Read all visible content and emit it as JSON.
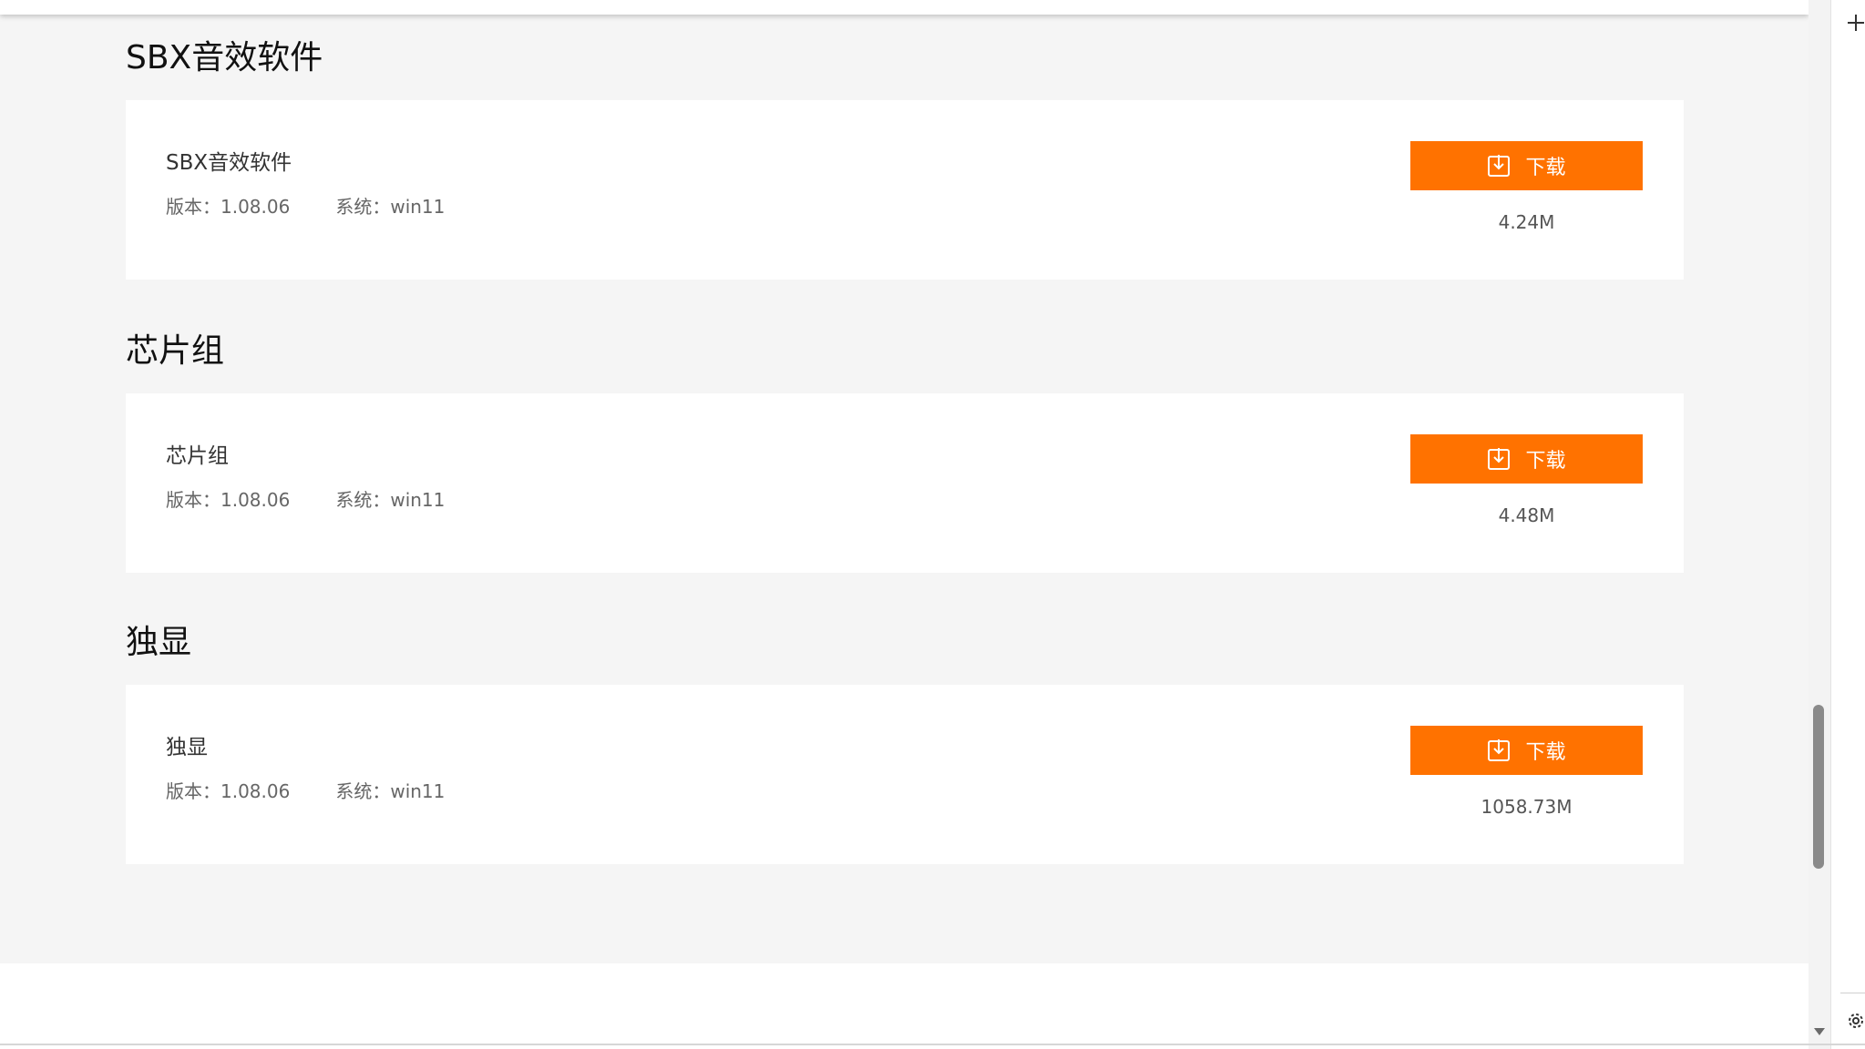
{
  "sections": [
    {
      "title": "SBX音效软件",
      "item_name": "SBX音效软件",
      "version_label": "版本：1.08.06",
      "system_label": "系统：win11",
      "download_label": "下载",
      "size": "4.24M"
    },
    {
      "title": "芯片组",
      "item_name": "芯片组",
      "version_label": "版本：1.08.06",
      "system_label": "系统：win11",
      "download_label": "下载",
      "size": "4.48M"
    },
    {
      "title": "独显",
      "item_name": "独显",
      "version_label": "版本：1.08.06",
      "system_label": "系统：win11",
      "download_label": "下载",
      "size": "1058.73M"
    }
  ],
  "colors": {
    "accent": "#ff7200",
    "page_bg": "#f5f5f5",
    "card_bg": "#ffffff"
  },
  "icons": {
    "download": "download-icon",
    "plus": "plus-icon",
    "settings": "gear-icon",
    "scroll_down": "chevron-down-icon"
  }
}
